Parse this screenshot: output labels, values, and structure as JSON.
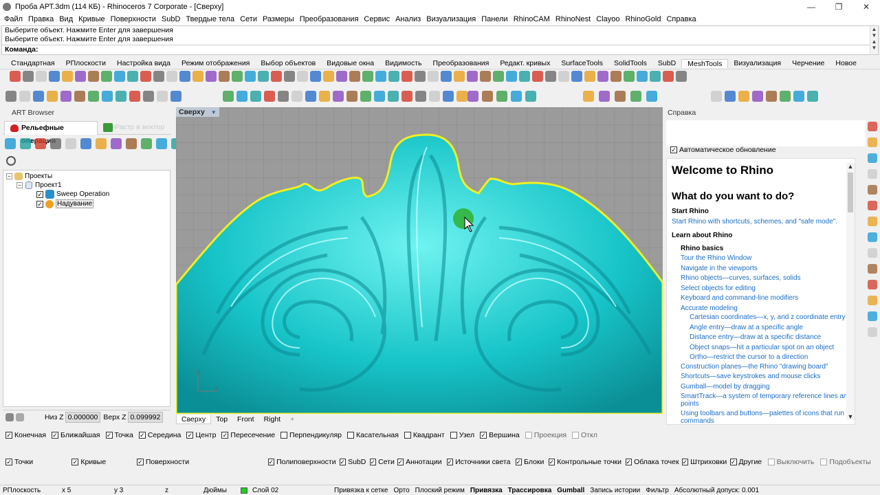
{
  "window": {
    "title": "Проба АРТ.3dm (114 КБ) - Rhinoceros 7 Corporate - [Сверху]"
  },
  "menu": [
    "Файл",
    "Правка",
    "Вид",
    "Кривые",
    "Поверхности",
    "SubD",
    "Твердые тела",
    "Сети",
    "Размеры",
    "Преобразования",
    "Сервис",
    "Анализ",
    "Визуализация",
    "Панели",
    "RhinoCAM",
    "RhinoNest",
    "Clayoo",
    "RhinoGold",
    "Справка"
  ],
  "command": {
    "history": [
      "Выберите объект. Нажмите Enter для завершения",
      "Выберите объект. Нажмите Enter для завершения"
    ],
    "prompt": "Команда:"
  },
  "toolbar_tabs": [
    "Стандартная",
    "РПлоскости",
    "Настройка вида",
    "Режим отображения",
    "Выбор объектов",
    "Видовые окна",
    "Видимость",
    "Преобразования",
    "Редакт. кривых",
    "SurfaceTools",
    "SolidTools",
    "SubD",
    "MeshTools",
    "Визуализация",
    "Черчение",
    "Новое"
  ],
  "active_toolbar_tab": "MeshTools",
  "art_browser": {
    "title": "ART Browser",
    "tab_active": "Рельефные операции",
    "tab_inactive": "Растр в вектор",
    "tree": {
      "root": "Проекты",
      "project": "Проект1",
      "items": [
        "Sweep Operation",
        "Надувание"
      ]
    },
    "low_z_label": "Низ Z",
    "low_z_value": "0.000000",
    "top_z_label": "Верх Z",
    "top_z_value": "0.099992"
  },
  "viewport": {
    "label": "Сверху",
    "tabs": [
      "Сверху",
      "Top",
      "Front",
      "Right"
    ],
    "axis_x": "x",
    "axis_y": "y",
    "model_color": "#1ec9cc",
    "outline_color": "#f0f020",
    "background_color": "#9b9b9b"
  },
  "help": {
    "title": "Справка",
    "auto_update": "Автоматическое обновление",
    "heading": "Welcome to Rhino",
    "subheading": "What do you want to do?",
    "start_title": "Start Rhino",
    "start_link": "Start Rhino with shortcuts, schemes, and \"safe mode\".",
    "learn_title": "Learn about Rhino",
    "basics_title": "Rhino basics",
    "links": [
      "Tour the Rhino Window",
      "Navigate in the viewports",
      "Rhino objects—curves, surfaces, solids",
      "Select objects for editing",
      "Keyboard and command-line modifiers",
      "Accurate modeling"
    ],
    "sublinks": [
      "Cartesian coordinates—x, y, and z coordinate entry",
      "Angle entry—draw at a specific angle",
      "Distance entry—draw at a specific distance",
      "Object snaps—hit a particular spot on an object",
      "Ortho—restrict the cursor to a direction"
    ],
    "links2": [
      "Construction planes—the Rhino \"drawing board\"",
      "Shortcuts—save keystrokes and mouse clicks",
      "Gumball—model by dragging",
      "SmartTrack—a system of temporary reference lines and",
      "points",
      "Using toolbars and buttons—palettes of icons that run",
      "commands"
    ]
  },
  "osnaps": [
    {
      "label": "Конечная",
      "on": true
    },
    {
      "label": "Ближайшая",
      "on": true
    },
    {
      "label": "Точка",
      "on": true
    },
    {
      "label": "Середина",
      "on": true
    },
    {
      "label": "Центр",
      "on": true
    },
    {
      "label": "Пересечение",
      "on": true
    },
    {
      "label": "Перпендикуляр",
      "on": false
    },
    {
      "label": "Касательная",
      "on": false
    },
    {
      "label": "Квадрант",
      "on": false
    },
    {
      "label": "Узел",
      "on": false
    },
    {
      "label": "Вершина",
      "on": true
    },
    {
      "label": "Проекция",
      "on": false,
      "dim": true
    },
    {
      "label": "Откл",
      "on": false,
      "dim": true
    }
  ],
  "filters": [
    {
      "label": "Точки",
      "on": true
    },
    {
      "label": "Кривые",
      "on": true
    },
    {
      "label": "Поверхности",
      "on": true
    },
    {
      "label": "Полиповерхности",
      "on": true
    },
    {
      "label": "SubD",
      "on": true
    },
    {
      "label": "Сети",
      "on": true
    },
    {
      "label": "Аннотации",
      "on": true
    },
    {
      "label": "Источники света",
      "on": true
    },
    {
      "label": "Блоки",
      "on": true
    },
    {
      "label": "Контрольные точки",
      "on": true
    },
    {
      "label": "Облака точек",
      "on": true
    },
    {
      "label": "Штриховки",
      "on": true
    },
    {
      "label": "Другие",
      "on": true
    },
    {
      "label": "Выключить",
      "on": false,
      "dim": true
    },
    {
      "label": "Подобъекты",
      "on": false,
      "dim": true
    }
  ],
  "status": {
    "cplane": "РПлоскость",
    "x": "x 5",
    "y": "y 3",
    "z": "z",
    "units": "Дюймы",
    "layer": "Слой 02",
    "layer_color": "#22cc22",
    "grid_snap": "Привязка к сетке",
    "ortho": "Орто",
    "planar": "Плоский режим",
    "osnap": "Привязка",
    "smarttrack": "Трассировка",
    "gumball": "Gumball",
    "history": "Запись истории",
    "filter": "Фильтр",
    "tolerance": "Абсолютный допуск: 0.001"
  }
}
